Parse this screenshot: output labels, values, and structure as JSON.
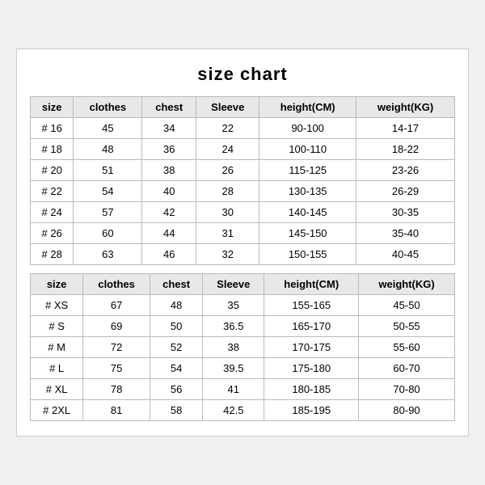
{
  "title": "size chart",
  "table1": {
    "headers": [
      "size",
      "clothes",
      "chest",
      "Sleeve",
      "height(CM)",
      "weight(KG)"
    ],
    "rows": [
      [
        "# 16",
        "45",
        "34",
        "22",
        "90-100",
        "14-17"
      ],
      [
        "# 18",
        "48",
        "36",
        "24",
        "100-110",
        "18-22"
      ],
      [
        "# 20",
        "51",
        "38",
        "26",
        "115-125",
        "23-26"
      ],
      [
        "# 22",
        "54",
        "40",
        "28",
        "130-135",
        "26-29"
      ],
      [
        "# 24",
        "57",
        "42",
        "30",
        "140-145",
        "30-35"
      ],
      [
        "# 26",
        "60",
        "44",
        "31",
        "145-150",
        "35-40"
      ],
      [
        "# 28",
        "63",
        "46",
        "32",
        "150-155",
        "40-45"
      ]
    ]
  },
  "table2": {
    "headers": [
      "size",
      "clothes",
      "chest",
      "Sleeve",
      "height(CM)",
      "weight(KG)"
    ],
    "rows": [
      [
        "# XS",
        "67",
        "48",
        "35",
        "155-165",
        "45-50"
      ],
      [
        "# S",
        "69",
        "50",
        "36.5",
        "165-170",
        "50-55"
      ],
      [
        "# M",
        "72",
        "52",
        "38",
        "170-175",
        "55-60"
      ],
      [
        "# L",
        "75",
        "54",
        "39.5",
        "175-180",
        "60-70"
      ],
      [
        "# XL",
        "78",
        "56",
        "41",
        "180-185",
        "70-80"
      ],
      [
        "# 2XL",
        "81",
        "58",
        "42.5",
        "185-195",
        "80-90"
      ]
    ]
  }
}
